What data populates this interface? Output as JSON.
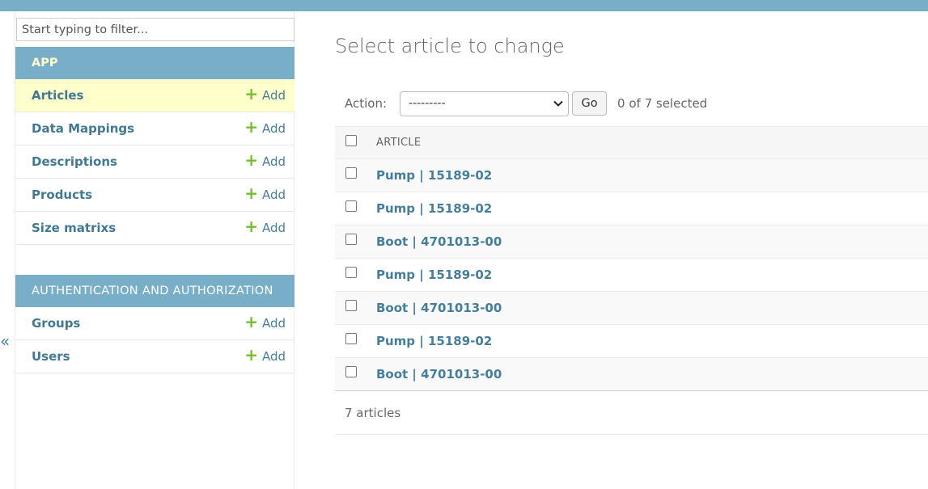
{
  "sidebar": {
    "filter_placeholder": "Start typing to filter...",
    "collapse_glyph": "«",
    "modules": [
      {
        "header": "APP",
        "models": [
          {
            "label": "Articles",
            "add_label": "Add",
            "active": true
          },
          {
            "label": "Data Mappings",
            "add_label": "Add"
          },
          {
            "label": "Descriptions",
            "add_label": "Add"
          },
          {
            "label": "Products",
            "add_label": "Add"
          },
          {
            "label": "Size matrixs",
            "add_label": "Add"
          }
        ]
      },
      {
        "header": "AUTHENTICATION AND AUTHORIZATION",
        "models": [
          {
            "label": "Groups",
            "add_label": "Add"
          },
          {
            "label": "Users",
            "add_label": "Add"
          }
        ]
      }
    ]
  },
  "main": {
    "title": "Select article to change",
    "action": {
      "label": "Action:",
      "selected_option": "---------",
      "go_label": "Go",
      "counter": "0 of 7 selected"
    },
    "table": {
      "column_header": "ARTICLE",
      "rows": [
        "Pump | 15189-02",
        "Pump | 15189-02",
        "Boot | 4701013-00",
        "Pump | 15189-02",
        "Boot | 4701013-00",
        "Pump | 15189-02",
        "Boot | 4701013-00"
      ]
    },
    "paginator": "7 articles"
  },
  "icons": {
    "add": "plus-icon",
    "select": "chevron-down-icon",
    "collapse": "double-chevron-left-icon"
  },
  "colors": {
    "header_bar": "#79aec8",
    "active_row": "#ffffcc",
    "link": "#447e9b",
    "add_plus": "#70bf2b"
  }
}
